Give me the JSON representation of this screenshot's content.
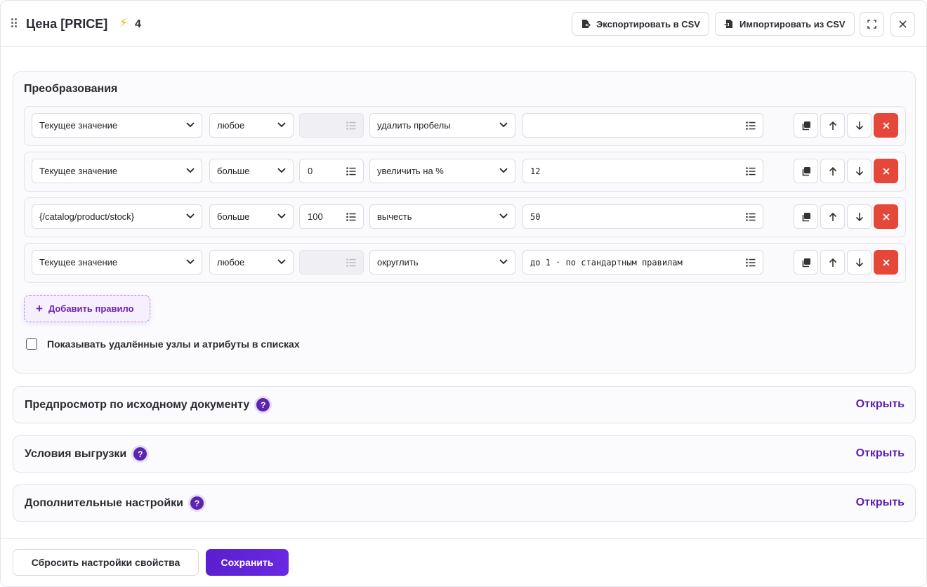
{
  "header": {
    "title": "Цена [PRICE]",
    "bolt_count": "4",
    "export_label": "Экспортировать в CSV",
    "import_label": "Импортировать из CSV"
  },
  "transformations": {
    "title": "Преобразования",
    "rules": [
      {
        "source": "Текущее значение",
        "condition": "любое",
        "threshold": "",
        "threshold_disabled": true,
        "action": "удалить пробелы",
        "value": ""
      },
      {
        "source": "Текущее значение",
        "condition": "больше",
        "threshold": "0",
        "threshold_disabled": false,
        "action": "увеличить на %",
        "value": "12"
      },
      {
        "source": "{/catalog/product/stock}",
        "condition": "больше",
        "threshold": "100",
        "threshold_disabled": false,
        "action": "вычесть",
        "value": "50"
      },
      {
        "source": "Текущее значение",
        "condition": "любое",
        "threshold": "",
        "threshold_disabled": true,
        "action": "округлить",
        "value": "до 1 · по стандартным правилам"
      }
    ],
    "add_rule_label": "Добавить правило",
    "show_deleted_label": "Показывать удалённые узлы и атрибуты в списках",
    "show_deleted_checked": false
  },
  "sections": [
    {
      "title": "Предпросмотр по исходному документу",
      "action": "Открыть"
    },
    {
      "title": "Условия выгрузки",
      "action": "Открыть"
    },
    {
      "title": "Дополнительные настройки",
      "action": "Открыть"
    }
  ],
  "help_glyph": "?",
  "footer": {
    "reset_label": "Сбросить настройки свойства",
    "save_label": "Сохранить"
  },
  "colors": {
    "accent": "#5b1fb0",
    "delete": "#e5483b",
    "bolt": "#f0b400"
  }
}
